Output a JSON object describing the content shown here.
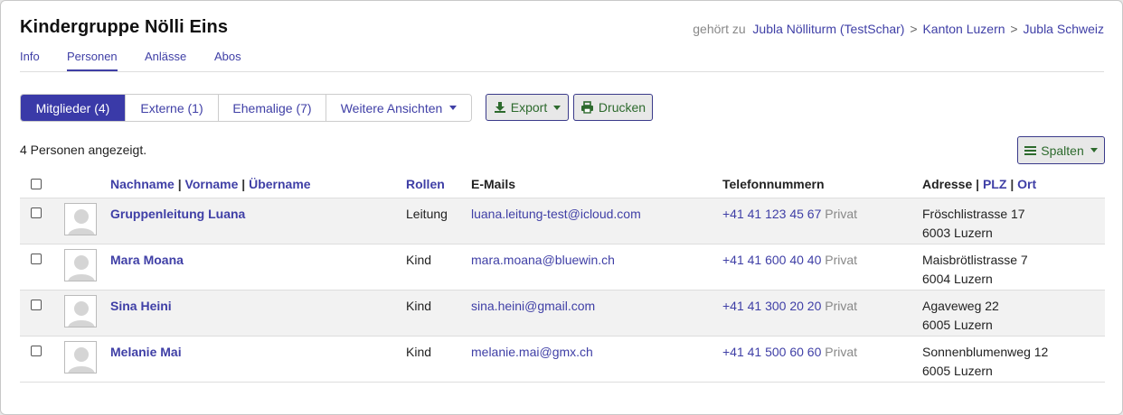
{
  "group": {
    "title": "Kindergruppe Nölli Eins",
    "belongs_label": "gehört zu",
    "breadcrumbs": [
      "Jubla Nölliturm (TestSchar)",
      "Kanton Luzern",
      "Jubla Schweiz"
    ],
    "separator": ">"
  },
  "tabs": [
    "Info",
    "Personen",
    "Anlässe",
    "Abos"
  ],
  "active_tab": "Personen",
  "views": {
    "members": "Mitglieder (4)",
    "external": "Externe (1)",
    "former": "Ehemalige (7)",
    "more": "Weitere Ansichten"
  },
  "actions": {
    "export": "Export",
    "print": "Drucken",
    "columns": "Spalten"
  },
  "summary": "4 Personen angezeigt.",
  "table": {
    "headers": {
      "lastname": "Nachname",
      "firstname": "Vorname",
      "nickname": "Übername",
      "roles": "Rollen",
      "emails": "E-Mails",
      "phones": "Telefonnummern",
      "address": "Adresse",
      "zip": "PLZ",
      "town": "Ort",
      "pipe": "|"
    },
    "rows": [
      {
        "name": "Gruppenleitung Luana",
        "role": "Leitung",
        "email": "luana.leitung-test@icloud.com",
        "phone": "+41 41 123 45 67",
        "phone_type": "Privat",
        "street": "Fröschlistrasse 17",
        "city": "6003 Luzern"
      },
      {
        "name": "Mara Moana",
        "role": "Kind",
        "email": "mara.moana@bluewin.ch",
        "phone": "+41 41 600 40 40",
        "phone_type": "Privat",
        "street": "Maisbrötlistrasse 7",
        "city": "6004 Luzern"
      },
      {
        "name": "Sina Heini",
        "role": "Kind",
        "email": "sina.heini@gmail.com",
        "phone": "+41 41 300 20 20",
        "phone_type": "Privat",
        "street": "Agaveweg 22",
        "city": "6005 Luzern"
      },
      {
        "name": "Melanie Mai",
        "role": "Kind",
        "email": "melanie.mai@gmx.ch",
        "phone": "+41 41 500 60 60",
        "phone_type": "Privat",
        "street": "Sonnenblumenweg 12",
        "city": "6005 Luzern"
      }
    ]
  },
  "colors": {
    "link": "#3f3fa6",
    "primary": "#3a3aa8",
    "success": "#2d6a2d"
  }
}
